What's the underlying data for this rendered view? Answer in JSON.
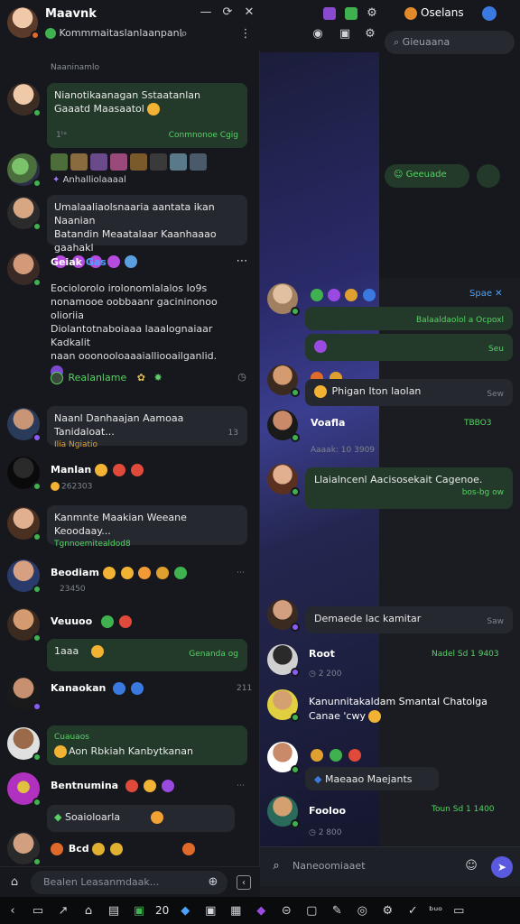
{
  "left": {
    "title": "Maavnk",
    "subtitle": "Kommmaitaslanlaanpanl",
    "feed_label": "Naaninamlo",
    "messages": [
      {
        "text1": "Nianotikaanagan Sstaatanlan",
        "text2": "Gaaatd Maasaatol",
        "meta": "1ᵗᵃ",
        "meta_right": "Conmnonoe Cgig"
      },
      {
        "text": "Anhalliolaaaal"
      },
      {
        "text1": "Umalaaliaolsnaaria aantata ikan Naanian",
        "text2": "Batandin Meaatalaar Kaanhaaao gaahakl"
      },
      {
        "name": "Geiak",
        "name_b": "Gas",
        "p1": "Eociolorolo irolonomlalalos Io9s",
        "p2": "nonamooe oobbaanr gacininonoo olioriia",
        "p3": "Diolantotnaboiaaa laaalognaiaar Kadkalit",
        "p4": "naan ooonooloaaaialliooailganlid.",
        "foot": "Realanlame"
      },
      {
        "text": "Naanl Danhaajan Aamoaa Tanidaloat...",
        "meta": "Ilia Ngiatio",
        "time": "13"
      },
      {
        "name": "Manlan",
        "sub": "262303"
      },
      {
        "name": "Kanmnte Maakian Weeane Keoodaay...",
        "sub": "Tgnnoemitealdod8"
      },
      {
        "name": "Beodiam",
        "sub": "23450"
      },
      {
        "name": "Veuuoo"
      },
      {
        "text": "1aaa",
        "meta_right": "Genanda og"
      },
      {
        "name": "Kanaokan",
        "time": "211"
      },
      {
        "label": "Cuauaos",
        "text": "Aon Rbkiah Kanbytkanan"
      },
      {
        "name": "Bentnumina"
      },
      {
        "text": "Soaioloarla"
      },
      {
        "name": "Bcd"
      }
    ],
    "input_placeholder": "Bealen Leasanmdaak..."
  },
  "right": {
    "title": "Oselans",
    "search_placeholder": "Gieuaana",
    "search_result": "Geeuade",
    "messages": [
      {
        "header_right": "Spae",
        "text": "Balaaldaolol a Ocpoxl",
        "meta": "Seu"
      },
      {
        "text": "Phigan Iton laolan",
        "meta": "Sew"
      },
      {
        "name": "Voafla",
        "meta": "Aaaak: 10 3909",
        "time": "TBBO3"
      },
      {
        "text": "Llaialncenl Aacisosekait Cagenoe.",
        "meta": "bos-bg ow"
      },
      {
        "text": "Demaede lac kamitar",
        "meta": "Saw"
      },
      {
        "name": "Root",
        "sub": "2 200",
        "time": "Nadel Sd 1 9403"
      },
      {
        "text1": "Kanunnitakaldam Smantal Chatolga",
        "text2": "Canae 'cwy"
      },
      {
        "pill": "Maeaao Maejants"
      },
      {
        "name": "Fooloo",
        "sub": "2 800",
        "time": "Toun Sd 1 1400"
      }
    ],
    "input_placeholder": "Naneoomiaaet"
  },
  "sysbar": {
    "t1": "20",
    "t2": "ᵇᵘᵒ"
  }
}
